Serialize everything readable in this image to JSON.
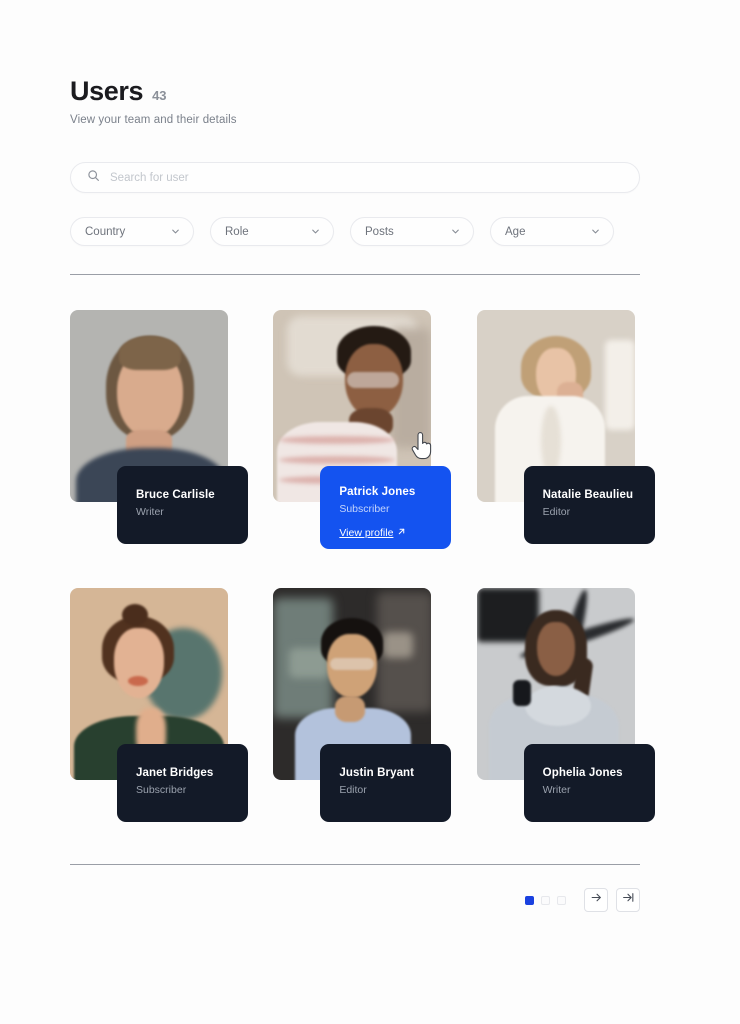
{
  "header": {
    "title": "Users",
    "count": "43",
    "subtitle": "View your team and their details"
  },
  "search": {
    "placeholder": "Search for user",
    "value": "",
    "icon": "search-icon"
  },
  "filters": [
    {
      "label": "Country",
      "icon": "chevron-down-icon"
    },
    {
      "label": "Role",
      "icon": "chevron-down-icon"
    },
    {
      "label": "Posts",
      "icon": "chevron-down-icon"
    },
    {
      "label": "Age",
      "icon": "chevron-down-icon"
    }
  ],
  "users": [
    {
      "name": "Bruce Carlisle",
      "role": "Writer",
      "active": false
    },
    {
      "name": "Patrick Jones",
      "role": "Subscriber",
      "active": true,
      "action_label": "View profile",
      "action_icon": "arrow-up-right-icon"
    },
    {
      "name": "Natalie Beaulieu",
      "role": "Editor",
      "active": false
    },
    {
      "name": "Janet Bridges",
      "role": "Subscriber",
      "active": false
    },
    {
      "name": "Justin Bryant",
      "role": "Editor",
      "active": false
    },
    {
      "name": "Ophelia Jones",
      "role": "Writer",
      "active": false
    }
  ],
  "pagination": {
    "pages": [
      {
        "active": true
      },
      {
        "active": false
      },
      {
        "active": false
      }
    ],
    "next_icon": "arrow-right-icon",
    "last_icon": "arrow-right-to-line-icon"
  },
  "colors": {
    "accent": "#1453f0",
    "dot_active": "#1a41e0",
    "card_dark": "#131a28",
    "title": "#1b1b1f",
    "muted": "#7b818b"
  },
  "cursor": {
    "icon": "pointing-hand-cursor"
  }
}
